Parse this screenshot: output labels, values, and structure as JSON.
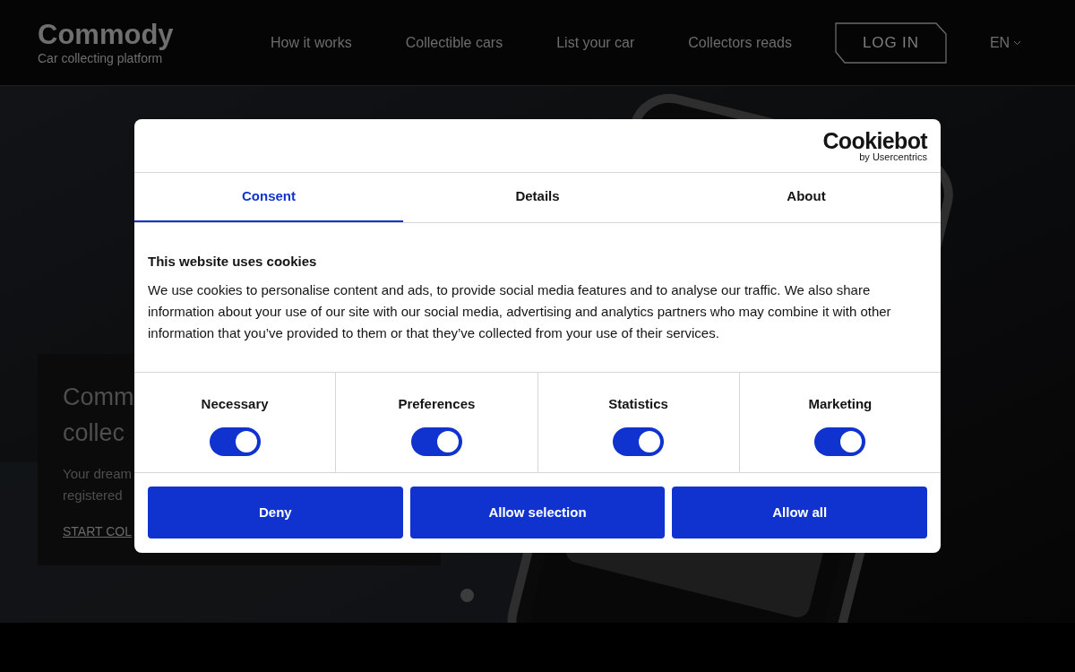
{
  "header": {
    "logo": {
      "name": "Commody",
      "tagline": "Car collecting platform"
    },
    "nav": [
      "How it works",
      "Collectible cars",
      "List your car",
      "Collectors reads"
    ],
    "login": "LOG IN",
    "language": "EN"
  },
  "hero": {
    "title_lines": [
      "Comm",
      "collec"
    ],
    "subtitle_lines": [
      "Your dream",
      "registered"
    ],
    "cta": "START COL"
  },
  "cookie_dialog": {
    "brand": "Cookiebot",
    "brand_sub": "by Usercentrics",
    "tabs": [
      {
        "label": "Consent",
        "selected": true
      },
      {
        "label": "Details",
        "selected": false
      },
      {
        "label": "About",
        "selected": false
      }
    ],
    "heading": "This website uses cookies",
    "body": "We use cookies to personalise content and ads, to provide social media features and to analyse our traffic. We also share information about your use of our site with our social media, advertising and analytics partners who may combine it with other information that you’ve provided to them or that they’ve collected from your use of their services.",
    "categories": [
      {
        "label": "Necessary",
        "on": true
      },
      {
        "label": "Preferences",
        "on": true
      },
      {
        "label": "Statistics",
        "on": true
      },
      {
        "label": "Marketing",
        "on": true
      }
    ],
    "buttons": [
      "Deny",
      "Allow selection",
      "Allow all"
    ]
  }
}
